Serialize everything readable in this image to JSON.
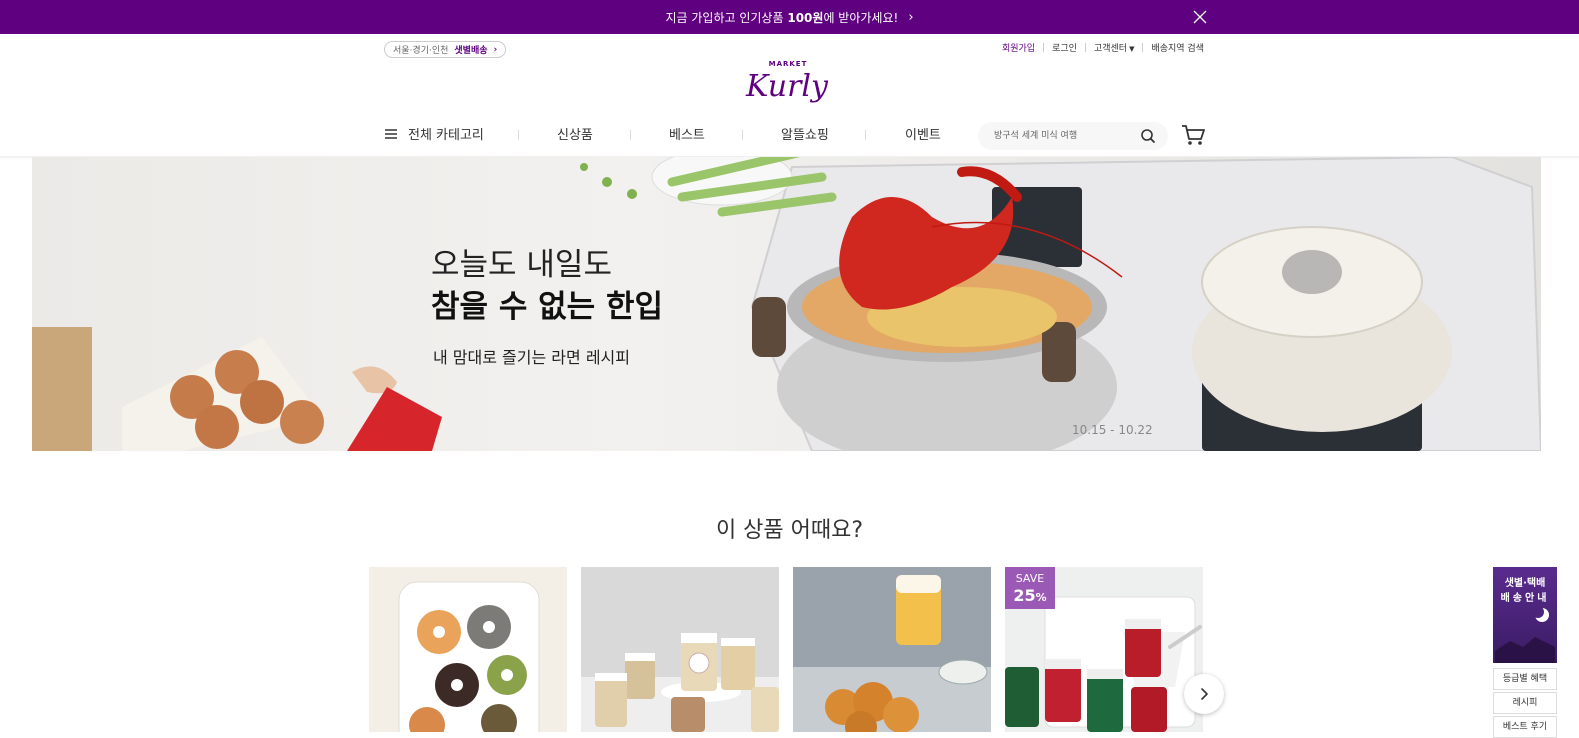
{
  "promo": {
    "text_prefix": "지금 가입하고 인기상품 ",
    "text_bold": "100원",
    "text_suffix": "에 받아가세요!"
  },
  "header": {
    "delivery_area": "서울·경기·인천",
    "delivery_type": "샛별배송",
    "user_links": [
      "회원가입",
      "로그인",
      "고객센터",
      "배송지역 검색"
    ],
    "logo_small": "MARKET",
    "logo_main": "Kurly"
  },
  "nav": {
    "all_category": "전체 카테고리",
    "items": [
      "신상품",
      "베스트",
      "알뜰쇼핑",
      "이벤트"
    ]
  },
  "search": {
    "placeholder": "방구석 세계 미식 여행"
  },
  "banner": {
    "line1": "오늘도 내일도",
    "line2": "참을 수 없는 한입",
    "subtitle": "내 맘대로 즐기는 라면 레시피",
    "date_range": "10.15 - 10.22"
  },
  "recommend": {
    "title": "이 상품 어때요?",
    "save_badge": {
      "label": "SAVE",
      "value": "25",
      "unit": "%"
    }
  },
  "quick_menu": {
    "banner_line1": "샛별·택배",
    "banner_line2": "배송안내",
    "items": [
      "등급별 혜택",
      "레시피",
      "베스트 후기"
    ]
  },
  "colors": {
    "brand": "#5f0080",
    "badge": "#9b59b6"
  }
}
